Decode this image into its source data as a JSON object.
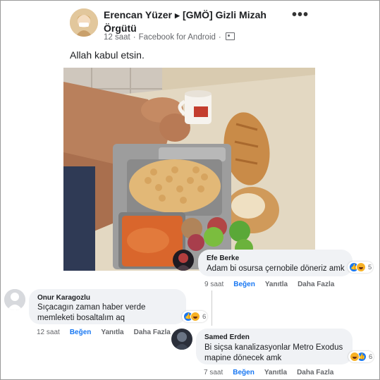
{
  "post": {
    "author": "Erencan Yüzer",
    "group": "[GMÖ] Gizli Mizah Örgütü",
    "time": "12 saat",
    "source": "Facebook for Android",
    "text": "Allah kabul etsin.",
    "more": "•••"
  },
  "comments": [
    {
      "name": "Efe Berke",
      "text": "Adam bi osursa çernobile döneriz amk",
      "time": "9 saat",
      "like": "Beğen",
      "reply": "Yanıtla",
      "more": "Daha Fazla",
      "reaction_count": "5"
    },
    {
      "name": "Onur Karagozlu",
      "text": "Sıçacagın zaman haber verde memleketi bosaltalım aq",
      "time": "12 saat",
      "like": "Beğen",
      "reply": "Yanıtla",
      "more": "Daha Fazla",
      "reaction_count": "6"
    },
    {
      "name": "Samed Erden",
      "text": "Bi siçsa kanalizasyonlar Metro Exodus mapine dönecek amk",
      "time": "7 saat",
      "like": "Beğen",
      "reply": "Yanıtla",
      "more": "Daha Fazla",
      "reaction_count": "6"
    }
  ],
  "colors": {
    "link_blue": "#1877f2",
    "meta_gray": "#65676b",
    "bubble_gray": "#f0f2f5"
  }
}
